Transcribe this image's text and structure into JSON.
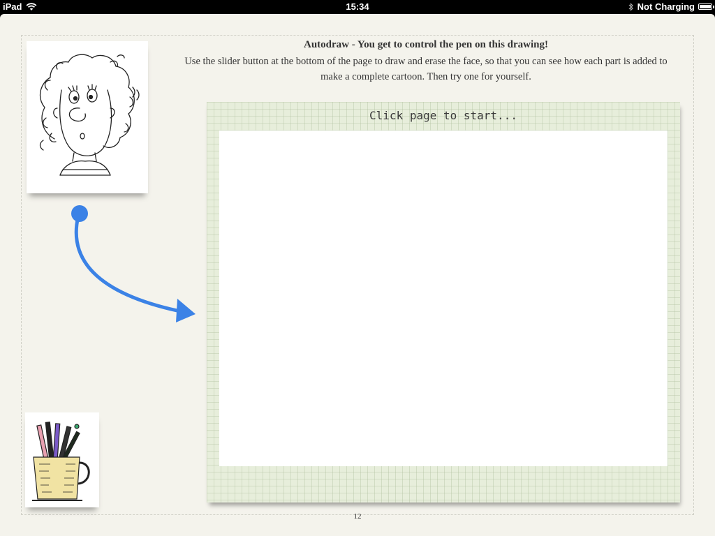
{
  "status_bar": {
    "device": "iPad",
    "wifi_icon": "wifi-icon",
    "time": "15:34",
    "bluetooth_icon": "bluetooth-icon",
    "charging": "Not Charging",
    "battery_icon": "battery-icon"
  },
  "header": {
    "title": "Autodraw - You get to control the pen on this drawing!",
    "description": "Use the slider button at the bottom of the page to draw and erase the face, so that you can see how each part is added to make a complete cartoon.  Then try one for yourself."
  },
  "thumbnails": {
    "face_icon": "cartoon-face-icon",
    "cup_icon": "pen-cup-icon"
  },
  "board": {
    "prompt": "Click page to start..."
  },
  "footer": {
    "page_number": "12"
  },
  "colors": {
    "arrow": "#3b82e6",
    "board": "#e7eedb",
    "page": "#f4f3ec"
  }
}
